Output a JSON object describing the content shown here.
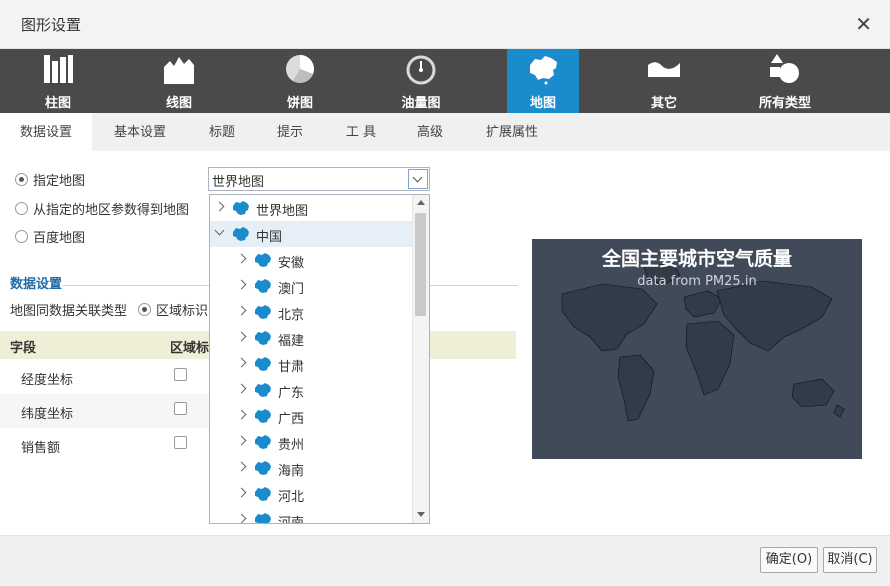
{
  "dialog": {
    "title": "图形设置"
  },
  "chart_types": [
    {
      "label": "柱图",
      "icon": "bar-chart-icon"
    },
    {
      "label": "线图",
      "icon": "line-chart-icon"
    },
    {
      "label": "饼图",
      "icon": "pie-chart-icon"
    },
    {
      "label": "油量图",
      "icon": "gauge-chart-icon"
    },
    {
      "label": "地图",
      "icon": "map-chart-icon",
      "active": true
    },
    {
      "label": "其它",
      "icon": "other-chart-icon"
    },
    {
      "label": "所有类型",
      "icon": "all-types-icon"
    }
  ],
  "tabs": [
    "数据设置",
    "基本设置",
    "标题",
    "提示",
    "工 具",
    "高级",
    "扩展属性"
  ],
  "map_source": {
    "options": [
      "指定地图",
      "从指定的地区参数得到地图",
      "百度地图"
    ],
    "selected": "指定地图",
    "combo_value": "世界地图"
  },
  "data_settings": {
    "section_title": "数据设置",
    "link_type_label": "地图同数据关联类型",
    "link_type_option": "区域标识"
  },
  "field_grid": {
    "headers": [
      "字段",
      "区域标"
    ],
    "rows": [
      "经度坐标",
      "纬度坐标",
      "销售额"
    ]
  },
  "map_tree": {
    "root_collapsed": "世界地图",
    "root_expanded": "中国",
    "children": [
      "安徽",
      "澳门",
      "北京",
      "福建",
      "甘肃",
      "广东",
      "广西",
      "贵州",
      "海南",
      "河北",
      "河南"
    ]
  },
  "preview": {
    "title": "全国主要城市空气质量",
    "subtitle": "data from PM25.in",
    "background": "#404a59"
  },
  "footer": {
    "ok": "确定(O)",
    "cancel": "取消(C)"
  },
  "colors": {
    "accent": "#1a8ccd",
    "toolbar": "#4a4a4a",
    "section": "#1f6ca8"
  }
}
